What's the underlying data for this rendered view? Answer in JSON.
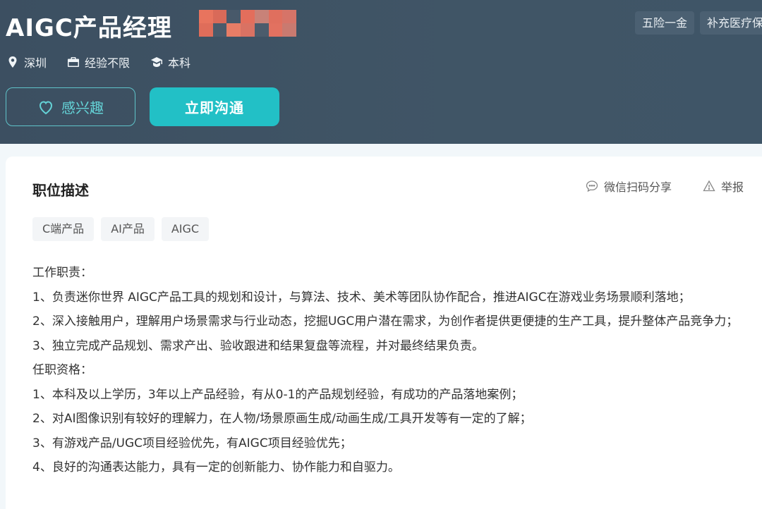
{
  "header": {
    "job_title": "AIGC产品经理",
    "benefits": [
      "五险一金",
      "补充医疗保险"
    ],
    "location": "深圳",
    "experience": "经验不限",
    "education": "本科",
    "interest_button": "感兴趣",
    "chat_button": "立即沟通",
    "colors": {
      "accent": "#22c0c6",
      "header_bg": "#3f5567"
    },
    "icons": [
      "location-pin-icon",
      "briefcase-icon",
      "graduation-cap-icon",
      "heart-icon"
    ]
  },
  "card": {
    "section_title": "职位描述",
    "share_label": "微信扫码分享",
    "report_label": "举报",
    "icons": [
      "chat-bubble-icon",
      "warning-icon"
    ],
    "skill_tags": [
      "C端产品",
      "AI产品",
      "AIGC"
    ],
    "description_lines": [
      "工作职责：",
      "1、负责迷你世界 AIGC产品工具的规划和设计，与算法、技术、美术等团队协作配合，推进AIGC在游戏业务场景顺利落地；",
      "2、深入接触用户，理解用户场景需求与行业动态，挖掘UGC用户潜在需求，为创作者提供更便捷的生产工具，提升整体产品竞争力；",
      "3、独立完成产品规划、需求产出、验收跟进和结果复盘等流程，并对最终结果负责。",
      "任职资格：",
      "1、本科及以上学历，3年以上产品经验，有从0-1的产品规划经验，有成功的产品落地案例；",
      "2、对AI图像识别有较好的理解力，在人物/场景原画生成/动画生成/工具开发等有一定的了解；",
      "3、有游戏产品/UGC项目经验优先，有AIGC项目经验优先；",
      "4、良好的沟通表达能力，具有一定的创新能力、协作能力和自驱力。"
    ]
  }
}
